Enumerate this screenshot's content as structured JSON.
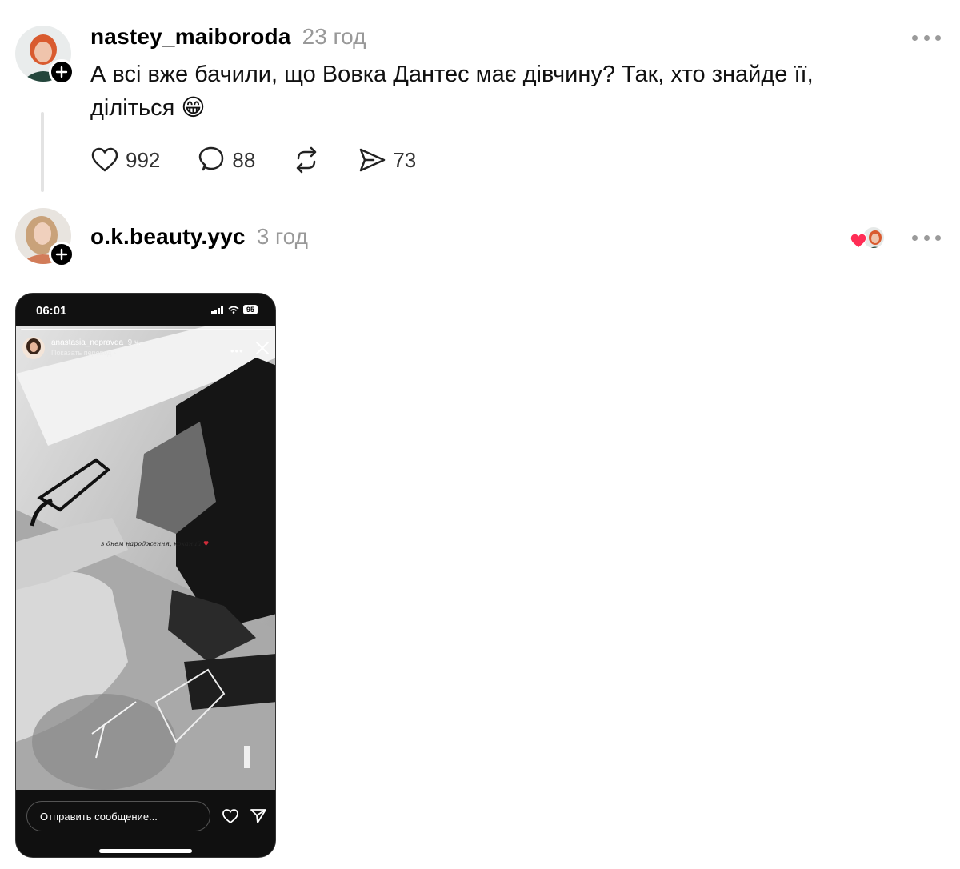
{
  "posts": [
    {
      "username": "nastey_maiboroda",
      "time": "23 год",
      "text": "А всі вже бачили, що Вовка Дантес має дівчину? Так, хто знайде її, діліться 😁",
      "likes": "992",
      "comments": "88",
      "shares": "73"
    },
    {
      "username": "o.k.beauty.yyc",
      "time": "3 год",
      "story": {
        "status_time": "06:01",
        "battery": "95",
        "username": "anastasia_nepravda",
        "age": "9 ч.",
        "translate": "Показать перевод",
        "caption": "з днем народження, коханий",
        "message_placeholder": "Отправить сообщение..."
      }
    }
  ],
  "colors": {
    "time_gray": "#999999",
    "like_red": "#ff2d55",
    "story_bg": "#111111"
  },
  "icons": [
    "plus-icon",
    "more-icon",
    "heart-icon",
    "comment-icon",
    "repost-icon",
    "send-icon",
    "close-icon"
  ]
}
